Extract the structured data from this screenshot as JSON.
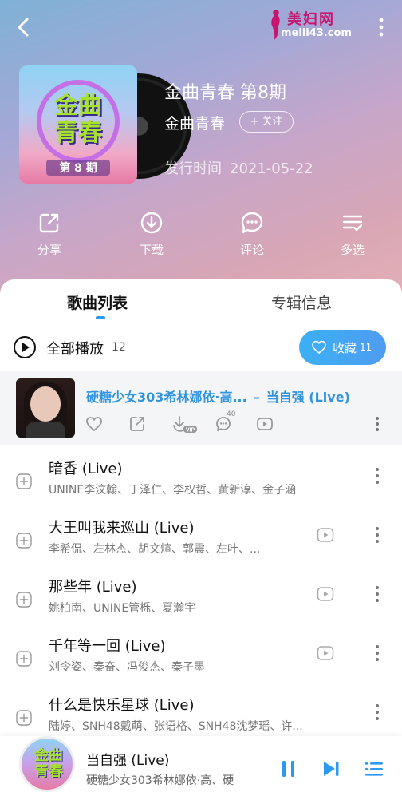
{
  "header": {
    "watermark_brand": "美妇网",
    "watermark_url": "meili43.com"
  },
  "album": {
    "cover_title": "金曲青春",
    "cover_episode": "第 8 期",
    "title": "金曲青春 第8期",
    "artist": "金曲青春",
    "follow_label": "+ 关注",
    "release_label": "发行时间",
    "release_date": "2021-05-22"
  },
  "actions": [
    {
      "label": "分享",
      "icon": "share-icon"
    },
    {
      "label": "下载",
      "icon": "download-icon"
    },
    {
      "label": "评论",
      "icon": "comment-icon"
    },
    {
      "label": "多选",
      "icon": "multiselect-icon"
    }
  ],
  "tabs": {
    "songs": "歌曲列表",
    "info": "专辑信息"
  },
  "playall": {
    "label": "全部播放",
    "count": "12"
  },
  "collect": {
    "label": "收藏",
    "count": "11"
  },
  "now_playing_row": {
    "artist": "硬糖少女303希林娜依·高...",
    "separator": "–",
    "title": "当自强 (Live)",
    "comment_count": "40",
    "vip_badge": "VIP"
  },
  "songs": [
    {
      "title": "暗香 (Live)",
      "artists": "UNINE李汶翰、丁泽仁、李权哲、黄新淳、金子涵",
      "has_mv": false
    },
    {
      "title": "大王叫我来巡山 (Live)",
      "artists": "李希侃、左林杰、胡文煊、郭震、左叶、...",
      "has_mv": true
    },
    {
      "title": "那些年 (Live)",
      "artists": "姚柏南、UNINE管栎、夏瀚宇",
      "has_mv": true
    },
    {
      "title": "千年等一回 (Live)",
      "artists": "刘令姿、秦奋、冯俊杰、秦子墨",
      "has_mv": true
    },
    {
      "title": "什么是快乐星球 (Live)",
      "artists": "陆婷、SNH48戴萌、张语格、SNH48沈梦瑶、许...",
      "has_mv": false
    }
  ],
  "player": {
    "disc_text": "金曲青春",
    "title": "当自强 (Live)",
    "artist": "硬糖少女303希林娜依·高、硬"
  },
  "colors": {
    "accent": "#2c9af0",
    "playing_text": "#2f93e0",
    "collect_button": "#3bb0f5"
  }
}
